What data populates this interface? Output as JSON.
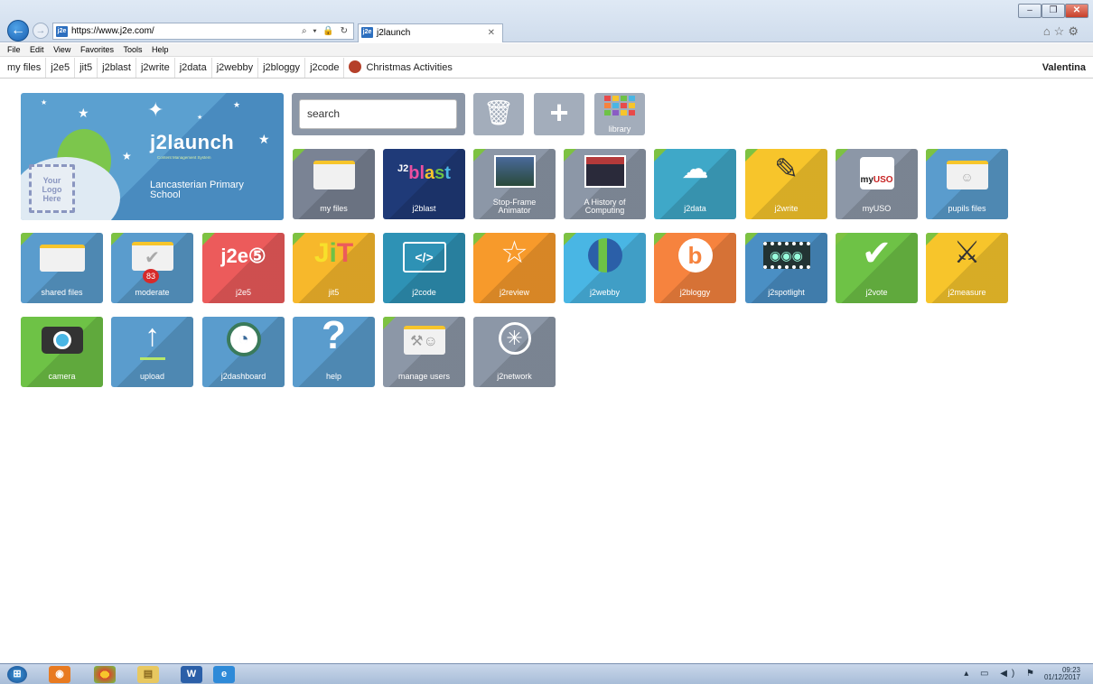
{
  "browser": {
    "url": "https://www.j2e.com/",
    "tab_title": "j2launch",
    "favicon_text": "j2e",
    "menu": [
      "File",
      "Edit",
      "View",
      "Favorites",
      "Tools",
      "Help"
    ],
    "favorites": [
      "my files",
      "j2e5",
      "jit5",
      "j2blast",
      "j2write",
      "j2data",
      "j2webby",
      "j2bloggy",
      "j2code"
    ],
    "favorites_special": "Christmas Activities",
    "user": "Valentina"
  },
  "hero": {
    "brand": "j2launch",
    "brand_sub": "Content Management System",
    "logo_placeholder": [
      "Your",
      "Logo",
      "Here"
    ],
    "school": "Lancasterian Primary School"
  },
  "search": {
    "text": "search"
  },
  "library_label": "library",
  "tiles": [
    {
      "label": "my files",
      "color": "#7a8394"
    },
    {
      "label": "j2blast",
      "color": "#1f3a78"
    },
    {
      "label": "Stop-Frame Animator",
      "color": "#8c97a7"
    },
    {
      "label": "A History of Computing",
      "color": "#8c97a7"
    },
    {
      "label": "j2data",
      "color": "#3fa8c8"
    },
    {
      "label": "j2write",
      "color": "#f7c52b"
    },
    {
      "label": "myUSO",
      "color": "#8c97a7"
    },
    {
      "label": "pupils files",
      "color": "#5a9ccd"
    },
    {
      "label": "shared files",
      "color": "#5a9ccd"
    },
    {
      "label": "moderate",
      "color": "#5a9ccd",
      "badge": "83"
    },
    {
      "label": "j2e5",
      "color": "#ec5b5b"
    },
    {
      "label": "jit5",
      "color": "#f7b82b"
    },
    {
      "label": "j2code",
      "color": "#2e92b5"
    },
    {
      "label": "j2review",
      "color": "#f79a2b"
    },
    {
      "label": "j2webby",
      "color": "#49b6e4"
    },
    {
      "label": "j2bloggy",
      "color": "#f6833e"
    },
    {
      "label": "j2spotlight",
      "color": "#4a8fc4"
    },
    {
      "label": "j2vote",
      "color": "#6ec246"
    },
    {
      "label": "j2measure",
      "color": "#f7c52b"
    },
    {
      "label": "camera",
      "color": "#6ec246"
    },
    {
      "label": "upload",
      "color": "#5a9ccd"
    },
    {
      "label": "j2dashboard",
      "color": "#5a9ccd"
    },
    {
      "label": "help",
      "color": "#5a9ccd"
    },
    {
      "label": "manage users",
      "color": "#8c97a7"
    },
    {
      "label": "j2network",
      "color": "#8c97a7"
    }
  ],
  "tray": {
    "time": "09:23",
    "date": "01/12/2017"
  }
}
